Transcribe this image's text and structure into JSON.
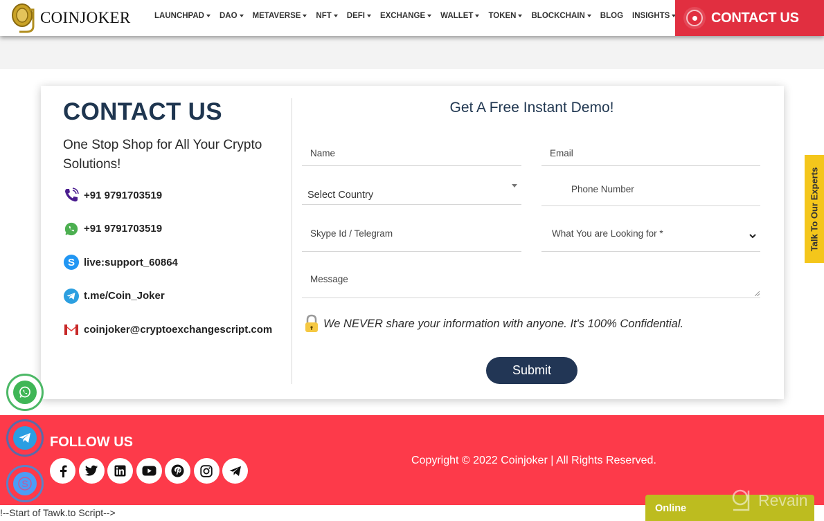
{
  "header": {
    "brand": "COINJOKER",
    "nav": [
      {
        "label": "LAUNCHPAD",
        "dropdown": true
      },
      {
        "label": "DAO",
        "dropdown": true
      },
      {
        "label": "METAVERSE",
        "dropdown": true
      },
      {
        "label": "NFT",
        "dropdown": true
      },
      {
        "label": "DEFI",
        "dropdown": true
      },
      {
        "label": "EXCHANGE",
        "dropdown": true
      },
      {
        "label": "WALLET",
        "dropdown": true
      },
      {
        "label": "TOKEN",
        "dropdown": true
      },
      {
        "label": "BLOCKCHAIN",
        "dropdown": true
      },
      {
        "label": "BLOG",
        "dropdown": false
      },
      {
        "label": "INSIGHTS",
        "dropdown": true
      }
    ],
    "contact_button": "CONTACT US",
    "accent_color": "#e12f40"
  },
  "contact": {
    "title": "CONTACT US",
    "tagline": "One Stop Shop for All Your Crypto Solutions!",
    "items": [
      {
        "icon": "phone-icon",
        "text": "+91 9791703519"
      },
      {
        "icon": "whatsapp-icon",
        "text": "+91 9791703519"
      },
      {
        "icon": "skype-icon",
        "text": "live:support_60864"
      },
      {
        "icon": "telegram-icon",
        "text": "t.me/Coin_Joker"
      },
      {
        "icon": "gmail-icon",
        "text": "coinjoker@cryptoexchangescript.com"
      }
    ]
  },
  "form": {
    "title": "Get A Free Instant Demo!",
    "name_placeholder": "Name",
    "email_placeholder": "Email",
    "country_value": "Select Country",
    "phone_placeholder": "Phone Number",
    "skype_placeholder": "Skype Id / Telegram",
    "looking_for_value": "What You are Looking for *",
    "message_placeholder": "Message",
    "privacy_note": "We NEVER share your information with anyone. It's 100% Confidential.",
    "submit_label": "Submit",
    "button_color": "#223655"
  },
  "side_tab": {
    "label": "Talk To Our Experts",
    "color": "#f4c61b"
  },
  "footer": {
    "follow_title": "FOLLOW US",
    "socials": [
      "facebook-icon",
      "twitter-icon",
      "linkedin-icon",
      "youtube-icon",
      "pinterest-icon",
      "instagram-icon",
      "telegram-icon"
    ],
    "copyright": "Copyright © 2022 Coinjoker | All Rights Reserved.",
    "bg_color": "#fd3a4a"
  },
  "floating": [
    "whatsapp-icon",
    "telegram-icon",
    "skype-icon"
  ],
  "tawk_comment": "!--Start of Tawk.to Script-->",
  "chat_widget": {
    "status": "Online",
    "watermark": "Revain"
  }
}
